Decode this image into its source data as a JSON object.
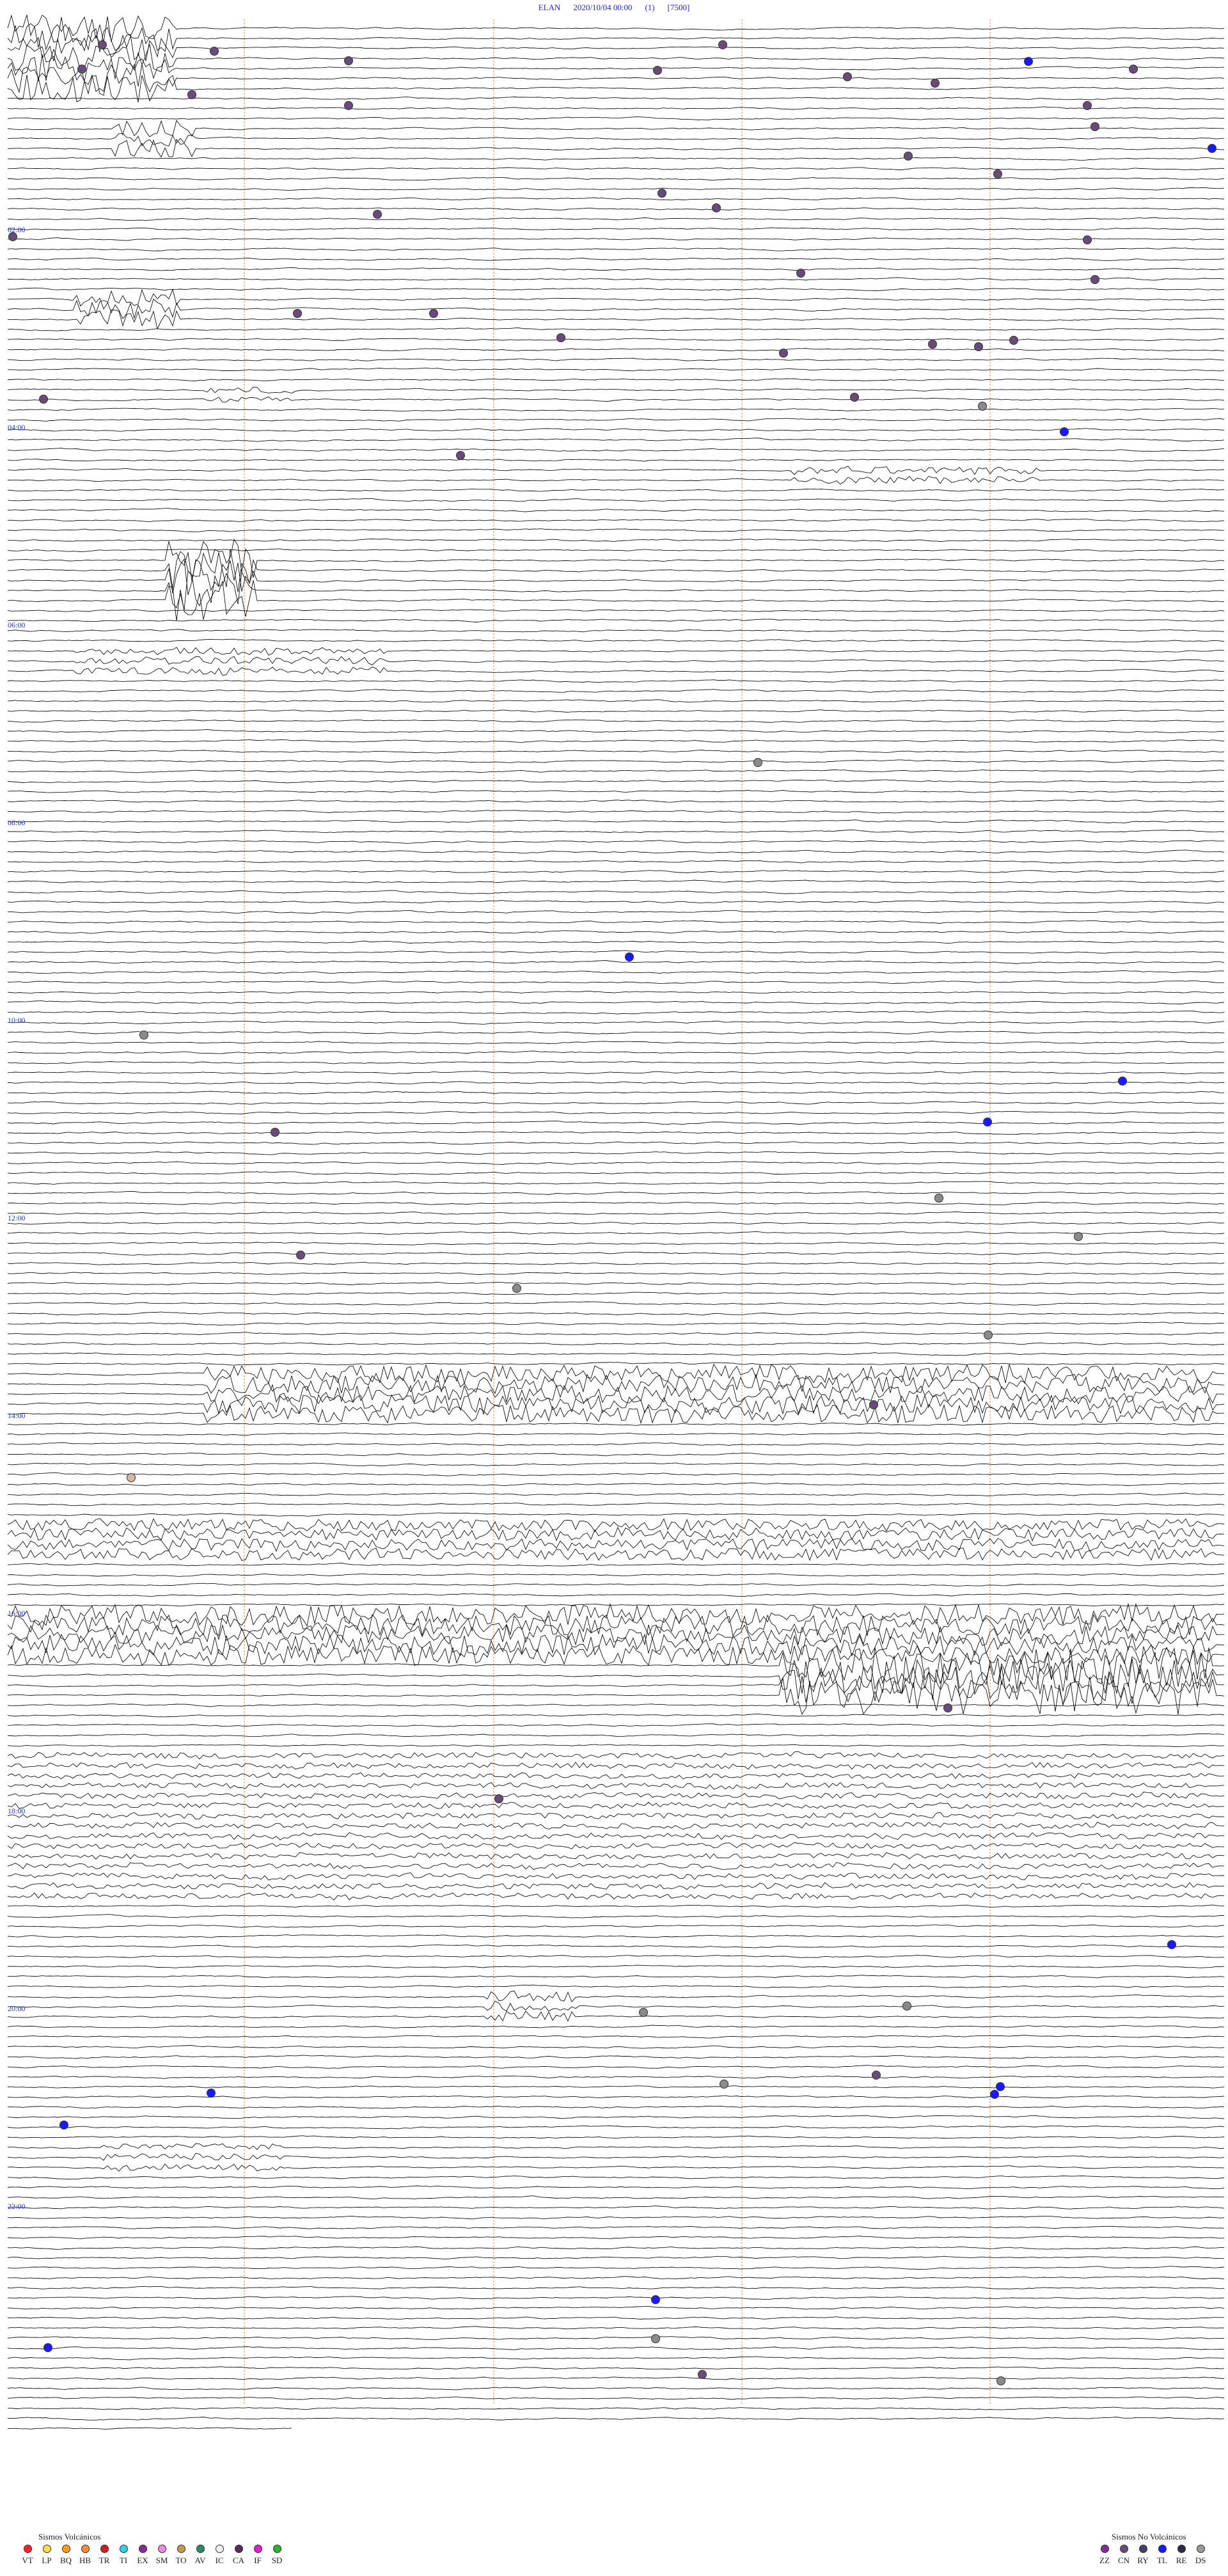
{
  "header": {
    "station": "ELAN",
    "datetime": "2020/10/04 00:00",
    "channel": "(1)",
    "scale": "[7500]"
  },
  "time_labels": [
    "02:00",
    "04:00",
    "06:00",
    "08:00",
    "10:00",
    "12:00",
    "14:00",
    "16:00",
    "18:00",
    "20:00",
    "22:00"
  ],
  "legend": {
    "volcanic": {
      "title": "Sismos Volcánicos",
      "items": [
        {
          "code": "VT",
          "color": "#ff2020"
        },
        {
          "code": "LP",
          "color": "#ffe040"
        },
        {
          "code": "BQ",
          "color": "#ff9e1e"
        },
        {
          "code": "HB",
          "color": "#ff8a30"
        },
        {
          "code": "TR",
          "color": "#cc2020"
        },
        {
          "code": "TI",
          "color": "#33d0e8"
        },
        {
          "code": "EX",
          "color": "#8a2a9a"
        },
        {
          "code": "SM",
          "color": "#f08ae0"
        },
        {
          "code": "TO",
          "color": "#c89a40"
        },
        {
          "code": "AV",
          "color": "#2a8a6a"
        },
        {
          "code": "IC",
          "color": "#f0f0f0"
        },
        {
          "code": "CA",
          "color": "#5a2a5a"
        },
        {
          "code": "IF",
          "color": "#e020d0"
        },
        {
          "code": "SD",
          "color": "#30b030"
        }
      ]
    },
    "non_volcanic": {
      "title": "Sismos No Volcánicos",
      "items": [
        {
          "code": "ZZ",
          "color": "#8a2a9a"
        },
        {
          "code": "CN",
          "color": "#6a4a7a"
        },
        {
          "code": "RY",
          "color": "#4a3a6a"
        },
        {
          "code": "TL",
          "color": "#1a1aff"
        },
        {
          "code": "RE",
          "color": "#2a2a4a"
        },
        {
          "code": "DS",
          "color": "#9a9a9a"
        }
      ]
    }
  },
  "colors": {
    "trace": "#111111",
    "time_marker": "#e8a060",
    "header_text": "#2222cc",
    "event_purple": "#6a4a7a",
    "event_gray": "#8a8a8a",
    "event_blue": "#1a1aff",
    "event_tan": "#d8b8a0"
  }
}
